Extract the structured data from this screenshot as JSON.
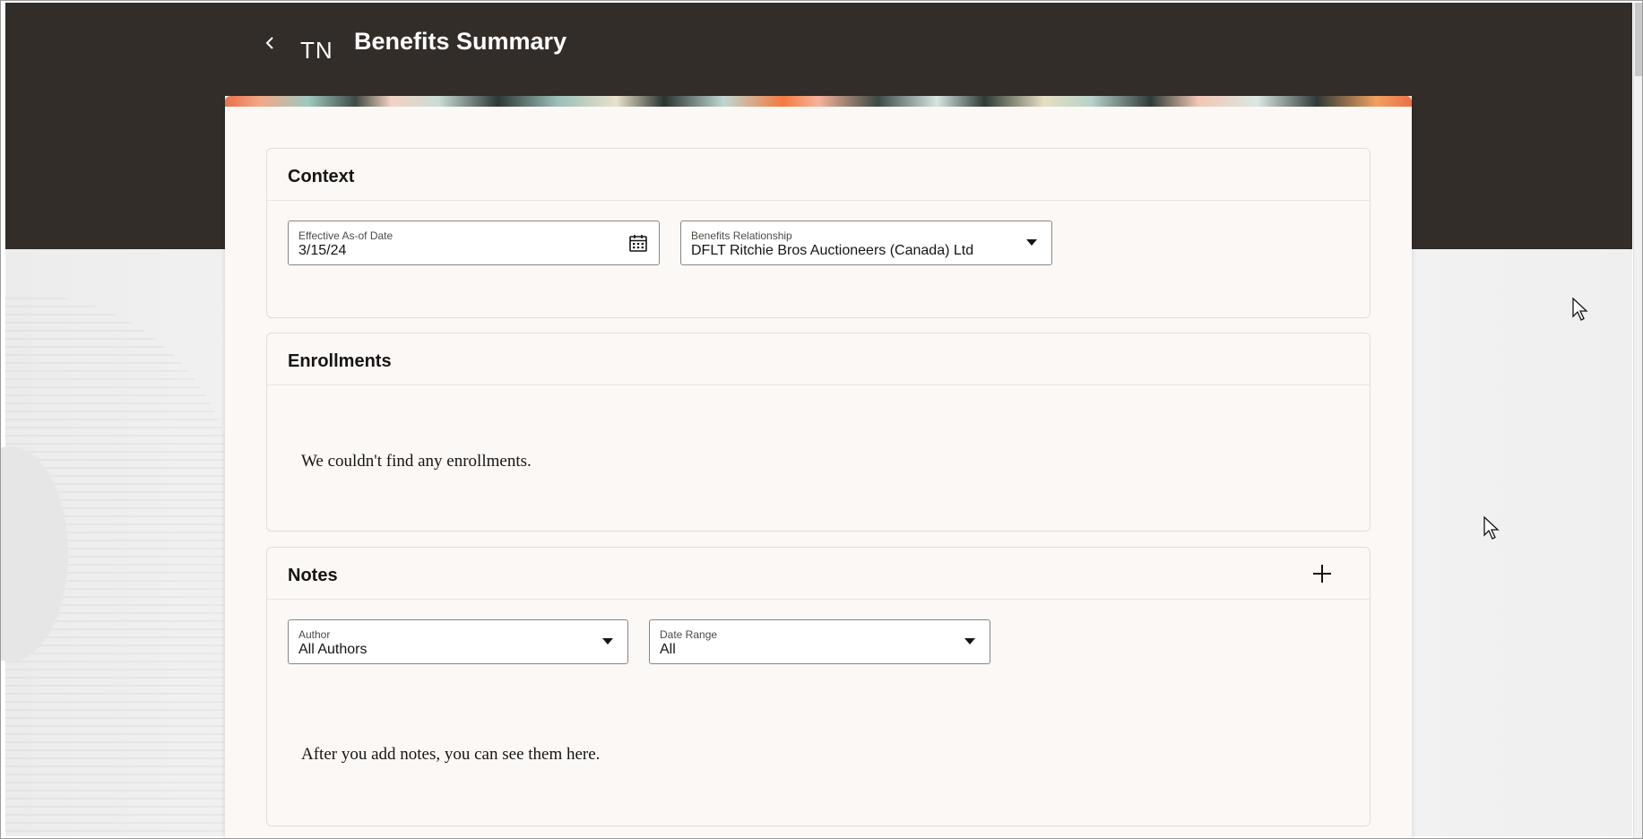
{
  "header": {
    "back_icon": "chevron-left-icon",
    "initials": "TN",
    "title": "Benefits Summary"
  },
  "context": {
    "title": "Context",
    "effective_date": {
      "label": "Effective As-of Date",
      "value": "3/15/24",
      "icon": "calendar-icon"
    },
    "benefits_relationship": {
      "label": "Benefits Relationship",
      "value": "DFLT Ritchie Bros Auctioneers (Canada) Ltd"
    }
  },
  "enrollments": {
    "title": "Enrollments",
    "empty_message": "We couldn't find any enrollments."
  },
  "notes": {
    "title": "Notes",
    "add_icon": "plus-icon",
    "author": {
      "label": "Author",
      "value": "All Authors"
    },
    "date_range": {
      "label": "Date Range",
      "value": "All"
    },
    "empty_message": "After you add notes, you can see them here."
  },
  "colors": {
    "header_bg": "#332d2a",
    "panel_bg": "#fcf8f6",
    "text": "#161513"
  }
}
